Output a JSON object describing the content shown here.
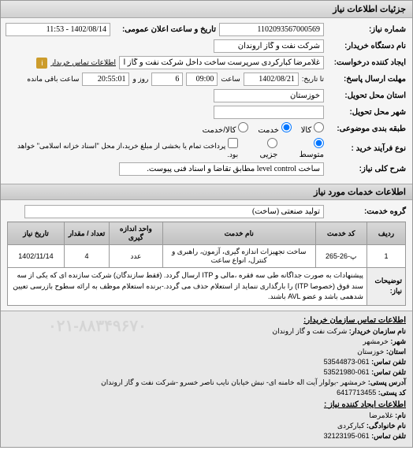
{
  "header": "جزئیات اطلاعات نیاز",
  "fields": {
    "request_no_label": "شماره نیاز:",
    "request_no": "1102093567000569",
    "announce_label": "تاریخ و ساعت اعلان عمومی:",
    "announce": "1402/08/14 - 11:53",
    "buyer_dev_label": "نام دستگاه خریدار:",
    "buyer_dev": "شرکت نفت و گاز اروندان",
    "creator_label": "ایجاد کننده درخواست:",
    "creator": "غلامرضا کبارکردی سرپرست ساخت داخل شرکت نفت و گاز اروندان",
    "contact_link": "اطلاعات تماس خریدار",
    "deadline_label": "مهلت ارسال پاسخ:",
    "to_date_label": "تا تاریخ:",
    "deadline_date": "1402/08/21",
    "time_label": "ساعت",
    "deadline_time": "09:00",
    "day_label": "روز و",
    "days_remain": "6",
    "remain_time": "20:55:01",
    "remain_label": "ساعت باقی مانده",
    "province_label": "استان محل تحویل:",
    "province": "خوزستان",
    "city_label": "شهر محل تحویل:",
    "city": "",
    "type_label": "طبقه بندی موضوعی:",
    "radio_kala": "کالا",
    "radio_khadmat": "خدمت",
    "radio_both": "کالا/خدمت",
    "process_label": "نوع فرآیند خرید :",
    "radio_metosat": "متوسط",
    "radio_jozei": "جزیی",
    "process_note": "پرداخت تمام یا بخشی از مبلغ خرید،از محل \"اسناد خزانه اسلامی\" خواهد بود.",
    "need_title_label": "شرح کلی نیاز:",
    "need_title": "ساخت level control مطابق تقاضا و اسناد فنی پیوست."
  },
  "services_header": "اطلاعات خدمات مورد نیاز",
  "service_group_label": "گروه خدمت:",
  "service_group": "تولید صنعتی (ساخت)",
  "table": {
    "headers": [
      "ردیف",
      "کد خدمت",
      "نام خدمت",
      "واحد اندازه گیری",
      "تعداد / مقدار",
      "تاریخ نیاز"
    ],
    "rows": [
      {
        "idx": "1",
        "code": "پ-26-265",
        "name": "ساخت تجهیزات اندازه گیری، آزمون، راهبری و کنترل، انواع ساعت",
        "unit": "عدد",
        "qty": "4",
        "date": "1402/11/14"
      }
    ],
    "desc_label": "توضیحات نیاز:",
    "desc": "پیشنهادات به صورت جداگانه طی سه فقره ،مالی و ITP ارسال گردد. (فقط سازندگان) شرکت سازنده ای که یکی از سه سند فوق (خصوصا ITP) را بارگذاری ننماید از استعلام حذف می گردد.-برنده استعلام موظف به ارائه سطوح بازرسی تعیین شدهمی باشد و عضو AVL باشند."
  },
  "contact": {
    "title1": "اطلاعات تماس سازمان خریدار:",
    "org_label": "نام سازمان خریدار:",
    "org": "شرکت نفت و گاز اروندان",
    "city_label": "شهر:",
    "city": "خرمشهر",
    "province_label": "استان:",
    "province": "خوزستان",
    "phone_label": "تلفن تماس:",
    "phone": "061-53544873",
    "fax_label": "تلفن تماس:",
    "fax": "061-53521980",
    "postal_label": "آدرس پستی:",
    "postal": "خرمشهر -بولوار آیت اله خامنه ای- نبش خیابان نایب ناصر خسرو -شرکت نفت و گاز اروندان",
    "postcode_label": "کد پستی:",
    "postcode": "6417713455",
    "title2": "اطلاعات ایجاد کننده نیاز :",
    "name_label": "نام:",
    "name": "غلامرضا",
    "family_label": "نام خانوادگی:",
    "family": "کبارکردی",
    "phone2_label": "تلفن تماس:",
    "phone2": "061-32123195",
    "watermark": "۰۲۱-۸۸۳۴۹۶۷۰"
  }
}
